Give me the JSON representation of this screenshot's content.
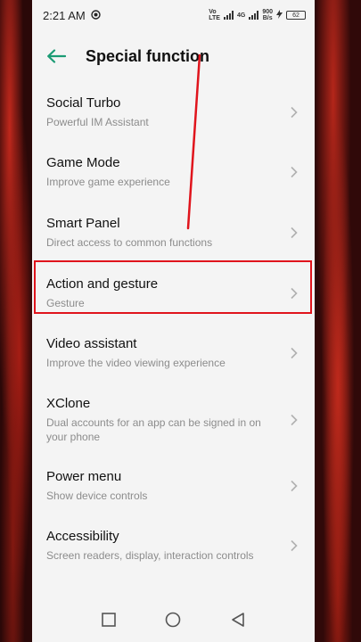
{
  "status": {
    "time": "2:21 AM",
    "volte_top": "Vo",
    "volte_bottom": "LTE",
    "net_type": "4G",
    "speed_value": "900",
    "speed_unit": "B/s",
    "battery": "62"
  },
  "header": {
    "title": "Special function"
  },
  "items": [
    {
      "title": "Social Turbo",
      "subtitle": "Powerful IM Assistant"
    },
    {
      "title": "Game Mode",
      "subtitle": "Improve game experience"
    },
    {
      "title": "Smart Panel",
      "subtitle": "Direct access to common functions"
    },
    {
      "title": "Action and gesture",
      "subtitle": "Gesture"
    },
    {
      "title": "Video assistant",
      "subtitle": "Improve the video viewing experience"
    },
    {
      "title": "XClone",
      "subtitle": "Dual accounts for an app can be signed in on your phone"
    },
    {
      "title": "Power menu",
      "subtitle": "Show device controls"
    },
    {
      "title": "Accessibility",
      "subtitle": "Screen readers, display, interaction controls"
    }
  ],
  "colors": {
    "accent": "#1a9b74",
    "highlight": "#e0141c"
  },
  "icons": {
    "back": "arrow-left-icon",
    "chevron": "chevron-right-icon",
    "recents": "square-icon",
    "home": "circle-icon",
    "back_nav": "triangle-back-icon"
  }
}
